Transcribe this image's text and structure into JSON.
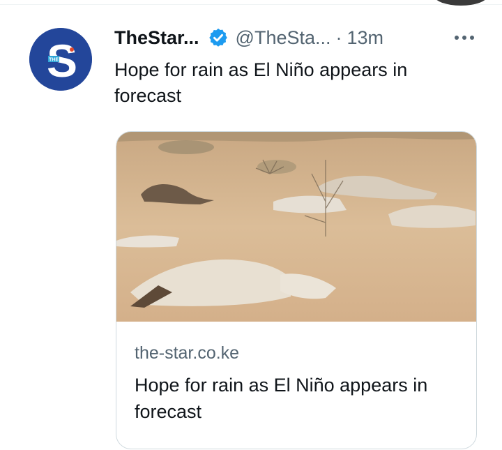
{
  "tweet": {
    "author_name": "TheStar...",
    "handle": "@TheSta...",
    "separator": "·",
    "timestamp": "13m",
    "text": "Hope for rain as El Niño appears in forecast",
    "avatar_letter": "S",
    "avatar_badge": "THE",
    "verified": true
  },
  "card": {
    "domain": "the-star.co.ke",
    "title": "Hope for rain as El Niño appears in forecast"
  },
  "colors": {
    "avatar_bg": "#23469a",
    "verified_blue": "#1d9bf0",
    "muted_text": "#536471"
  },
  "icons": [
    "verified-badge-icon",
    "more-options-icon"
  ]
}
